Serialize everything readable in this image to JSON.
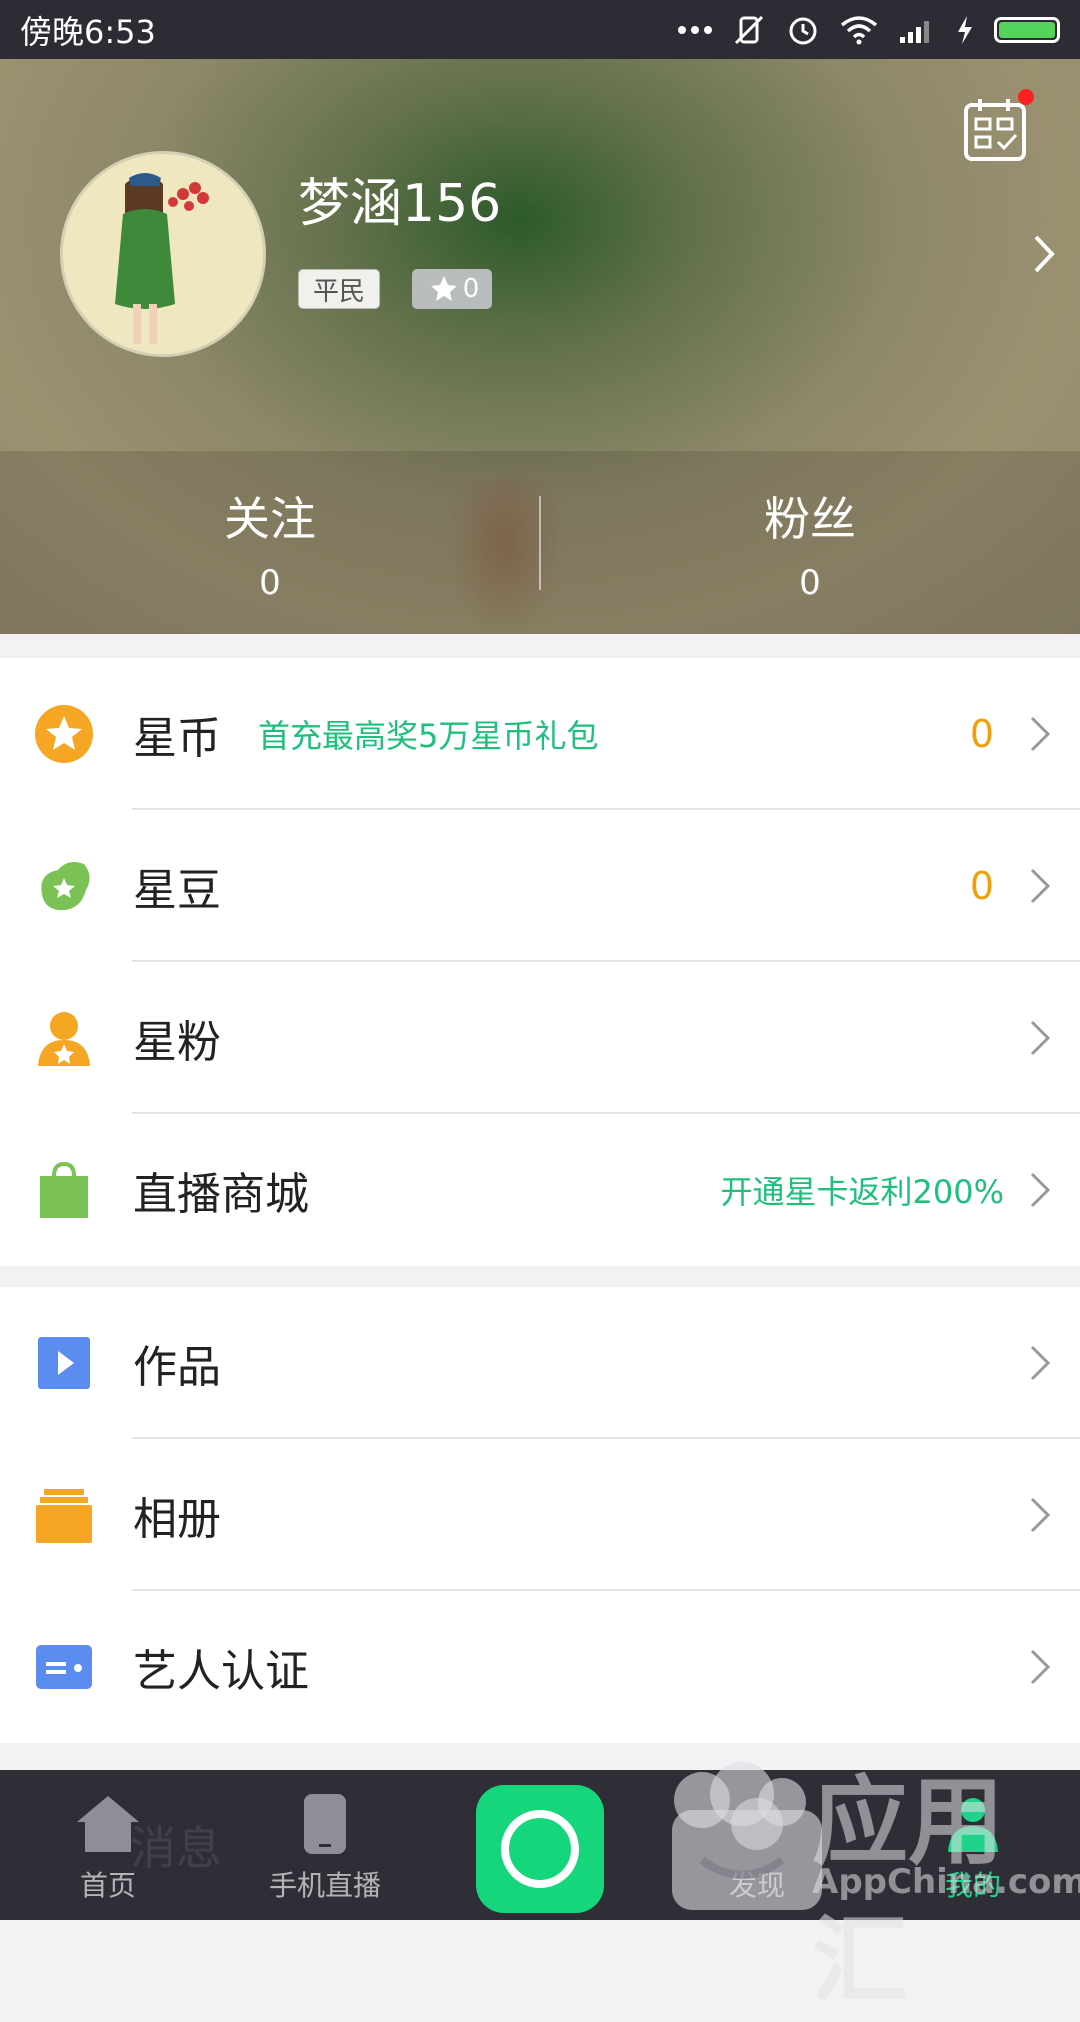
{
  "status_bar": {
    "time": "傍晚6:53"
  },
  "profile": {
    "username": "梦涵156",
    "rank_badge": "平民",
    "star_level": "0",
    "stats": [
      {
        "label": "关注",
        "value": "0"
      },
      {
        "label": "粉丝",
        "value": "0"
      }
    ]
  },
  "menu_group_1": [
    {
      "label": "星币",
      "promo": "首充最高奖5万星币礼包",
      "count": "0",
      "icon": "star-coin-icon",
      "color": "#f5a623"
    },
    {
      "label": "星豆",
      "count": "0",
      "icon": "star-bean-icon",
      "color": "#7ac256"
    },
    {
      "label": "星粉",
      "icon": "star-fan-icon",
      "color": "#f5a623"
    },
    {
      "label": "直播商城",
      "promo": "开通星卡返利200%",
      "icon": "shopping-bag-icon",
      "color": "#7ac256"
    }
  ],
  "menu_group_2": [
    {
      "label": "作品",
      "icon": "play-icon",
      "color": "#5b8cf0"
    },
    {
      "label": "相册",
      "icon": "album-icon",
      "color": "#f5a623"
    },
    {
      "label": "艺人认证",
      "icon": "id-card-icon",
      "color": "#5b8cf0"
    }
  ],
  "tab_bar": {
    "tabs": [
      {
        "label": "首页",
        "icon": "home-icon"
      },
      {
        "label": "手机直播",
        "icon": "phone-icon"
      },
      {
        "label": "发现",
        "icon": "discover-icon"
      },
      {
        "label": "我的",
        "icon": "me-icon",
        "active": true
      }
    ],
    "faded_label": "消息"
  },
  "watermark": {
    "title": "应用汇",
    "subtitle": "AppChina.com"
  },
  "colors": {
    "accent_green": "#21d38a",
    "promo_green": "#1fbf7c",
    "count_orange": "#f0a00a"
  }
}
